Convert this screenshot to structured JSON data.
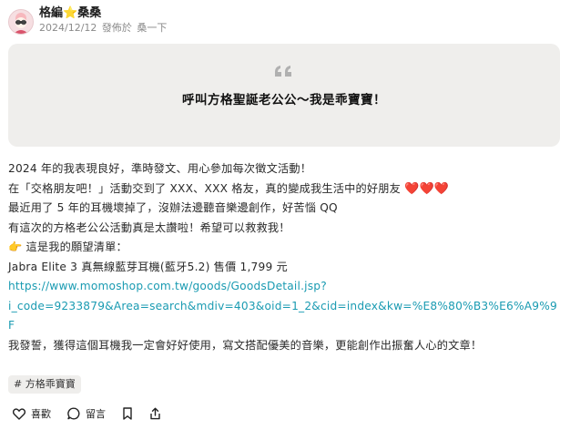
{
  "post": {
    "author": {
      "name": "格編",
      "star": "⭐",
      "name_suffix": "桑桑"
    },
    "date": "2024/12/12",
    "published_in_label": "發佈於",
    "board": "桑一下"
  },
  "quote": {
    "mark": "❝",
    "title": "呼叫方格聖誕老公公～我是乖寶寶！"
  },
  "content": {
    "lines": [
      "2024 年的我表現良好，準時發文、用心參加每次徵文活動！",
      "在「交格朋友吧！」活動交到了 XXX、XXX 格友，真的變成我生活中的好朋友",
      "最近用了 5 年的耳機壞掉了，沒辦法邊聽音樂邊創作，好苦惱 QQ",
      "有這次的方格老公公活動真是太讚啦！希望可以救救我！",
      "這是我的願望清單：",
      "Jabra Elite 3 真無線藍芽耳機(藍牙5.2) 售價 1,799 元",
      "我發誓，獲得這個耳機我一定會好好使用，寫文搭配優美的音樂，更能創作出振奮人心的文章！"
    ],
    "hearts": "❤️❤️❤️",
    "pointer": "👉",
    "link_line1": "https://www.momoshop.com.tw/goods/GoodsDetail.jsp?",
    "link_line2": "i_code=9233879&Area=search&mdiv=403&oid=1_2&cid=index&kw=%E8%80%B3%E6%A9%9F"
  },
  "tag": "# 方格乖寶寶",
  "actions": {
    "like": "喜歡",
    "comment": "留言"
  },
  "colors": {
    "link": "#1a9bb2",
    "card_bg": "#efeeec",
    "heart": "#e0202b"
  }
}
